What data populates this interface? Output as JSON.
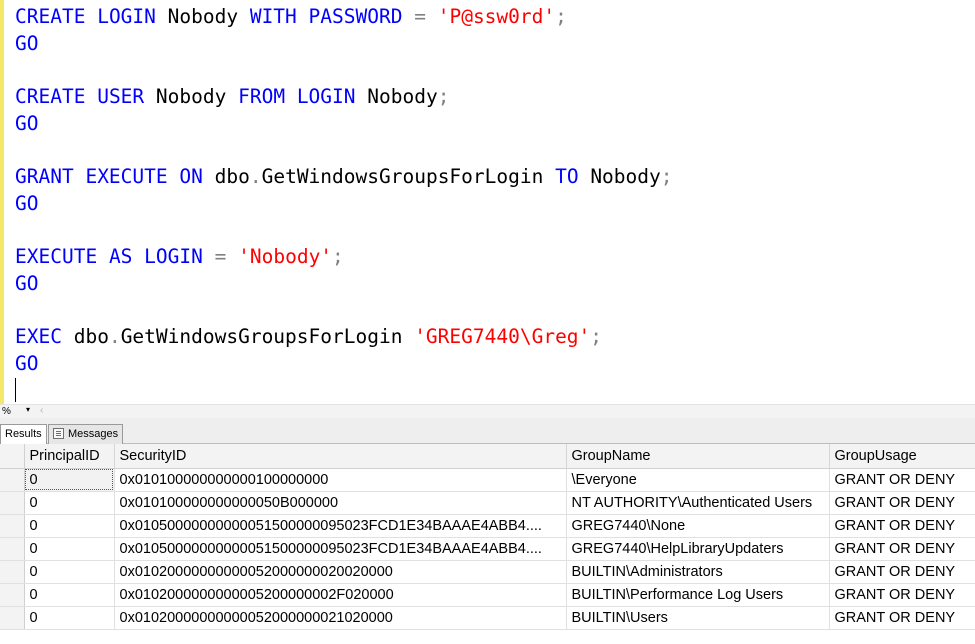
{
  "editor": {
    "lines": [
      {
        "tokens": [
          {
            "t": "CREATE",
            "c": "kw"
          },
          {
            "t": " "
          },
          {
            "t": "LOGIN",
            "c": "kw"
          },
          {
            "t": " Nobody "
          },
          {
            "t": "WITH",
            "c": "kw"
          },
          {
            "t": " "
          },
          {
            "t": "PASSWORD",
            "c": "kw"
          },
          {
            "t": " "
          },
          {
            "t": "=",
            "c": "gray"
          },
          {
            "t": " "
          },
          {
            "t": "'P@ssw0rd'",
            "c": "str"
          },
          {
            "t": ";",
            "c": "gray"
          }
        ]
      },
      {
        "tokens": [
          {
            "t": "GO",
            "c": "kw"
          }
        ]
      },
      {
        "tokens": []
      },
      {
        "tokens": [
          {
            "t": "CREATE",
            "c": "kw"
          },
          {
            "t": " "
          },
          {
            "t": "USER",
            "c": "kw"
          },
          {
            "t": " Nobody "
          },
          {
            "t": "FROM",
            "c": "kw"
          },
          {
            "t": " "
          },
          {
            "t": "LOGIN",
            "c": "kw"
          },
          {
            "t": " Nobody"
          },
          {
            "t": ";",
            "c": "gray"
          }
        ]
      },
      {
        "tokens": [
          {
            "t": "GO",
            "c": "kw"
          }
        ]
      },
      {
        "tokens": []
      },
      {
        "tokens": [
          {
            "t": "GRANT",
            "c": "kw"
          },
          {
            "t": " "
          },
          {
            "t": "EXECUTE",
            "c": "kw"
          },
          {
            "t": " "
          },
          {
            "t": "ON",
            "c": "kw"
          },
          {
            "t": " dbo"
          },
          {
            "t": ".",
            "c": "gray"
          },
          {
            "t": "GetWindowsGroupsForLogin "
          },
          {
            "t": "TO",
            "c": "kw"
          },
          {
            "t": " Nobody"
          },
          {
            "t": ";",
            "c": "gray"
          }
        ]
      },
      {
        "tokens": [
          {
            "t": "GO",
            "c": "kw"
          }
        ]
      },
      {
        "tokens": []
      },
      {
        "tokens": [
          {
            "t": "EXECUTE",
            "c": "kw"
          },
          {
            "t": " "
          },
          {
            "t": "AS",
            "c": "kw"
          },
          {
            "t": " "
          },
          {
            "t": "LOGIN",
            "c": "kw"
          },
          {
            "t": " "
          },
          {
            "t": "=",
            "c": "gray"
          },
          {
            "t": " "
          },
          {
            "t": "'Nobody'",
            "c": "str"
          },
          {
            "t": ";",
            "c": "gray"
          }
        ]
      },
      {
        "tokens": [
          {
            "t": "GO",
            "c": "kw"
          }
        ]
      },
      {
        "tokens": []
      },
      {
        "tokens": [
          {
            "t": "EXEC",
            "c": "kw"
          },
          {
            "t": " dbo"
          },
          {
            "t": ".",
            "c": "gray"
          },
          {
            "t": "GetWindowsGroupsForLogin "
          },
          {
            "t": "'GREG7440\\Greg'",
            "c": "str"
          },
          {
            "t": ";",
            "c": "gray"
          }
        ]
      },
      {
        "tokens": [
          {
            "t": "GO",
            "c": "kw"
          }
        ]
      }
    ]
  },
  "zoom": {
    "value": "%",
    "dropdown_glyph": "▾",
    "scroll_glyph": "‹"
  },
  "tabs": [
    {
      "label": "Results",
      "active": true
    },
    {
      "label": "Messages",
      "active": false
    }
  ],
  "results": {
    "columns": [
      "PrincipalID",
      "SecurityID",
      "GroupName",
      "GroupUsage"
    ],
    "rows": [
      [
        "0",
        "0x010100000000000100000000",
        "\\Everyone",
        "GRANT OR DENY"
      ],
      [
        "0",
        "0x010100000000000050B000000",
        "NT AUTHORITY\\Authenticated Users",
        "GRANT OR DENY"
      ],
      [
        "0",
        "0x0105000000000005150000009502 3FCD1E34BAAAE4ABB4...",
        "GREG7440\\None",
        "GRANT OR DENY"
      ],
      [
        "0",
        "0x0105000000000005150000009502 3FCD1E34BAAAE4ABB4...",
        "GREG7440\\HelpLibraryUpdaters",
        "GRANT OR DENY"
      ],
      [
        "0",
        "0x010200000000000520000000200 20000",
        "BUILTIN\\Administrators",
        "GRANT OR DENY"
      ],
      [
        "0",
        "0x010200000000000520000000 2F020000",
        "BUILTIN\\Performance Log Users",
        "GRANT OR DENY"
      ],
      [
        "0",
        "0x01020000000000052000000021020000",
        "BUILTIN\\Users",
        "GRANT OR DENY"
      ]
    ]
  }
}
